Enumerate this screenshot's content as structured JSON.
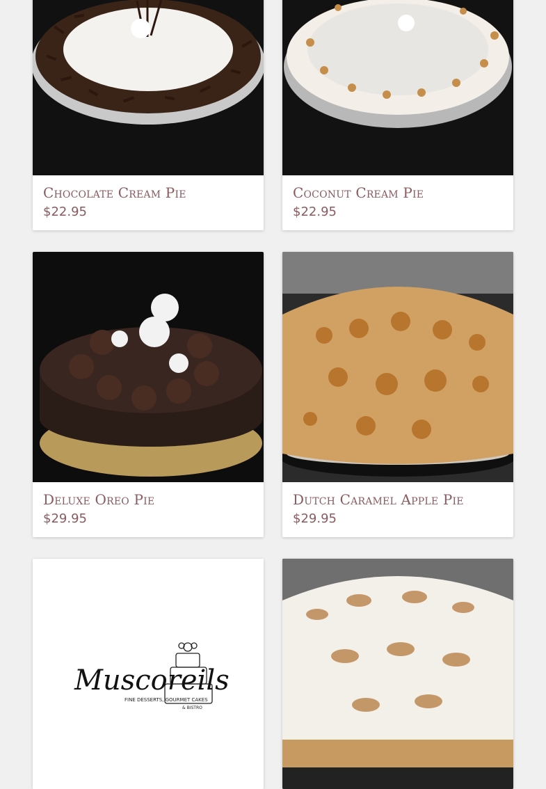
{
  "products": [
    {
      "name": "Chocolate Cream Pie",
      "price": "$22.95",
      "image_desc": "chocolate-cream-pie-photo"
    },
    {
      "name": "Coconut Cream Pie",
      "price": "$22.95",
      "image_desc": "coconut-cream-pie-photo"
    },
    {
      "name": "Deluxe Oreo Pie",
      "price": "$29.95",
      "image_desc": "deluxe-oreo-pie-photo"
    },
    {
      "name": "Dutch Caramel Apple Pie",
      "price": "$29.95",
      "image_desc": "dutch-caramel-apple-pie-photo"
    },
    {
      "name": "",
      "price": "",
      "image_desc": "muscoreils-logo-placeholder"
    },
    {
      "name": "",
      "price": "",
      "image_desc": "meringue-pie-photo"
    }
  ],
  "logo": {
    "brand": "Muscoreils",
    "tagline": "FINE DESSERTS, GOURMET CAKES",
    "sub": "& BISTRO"
  },
  "colors": {
    "text_accent": "#8a5a5e",
    "page_bg": "#f0f0f0",
    "card_bg": "#ffffff"
  }
}
